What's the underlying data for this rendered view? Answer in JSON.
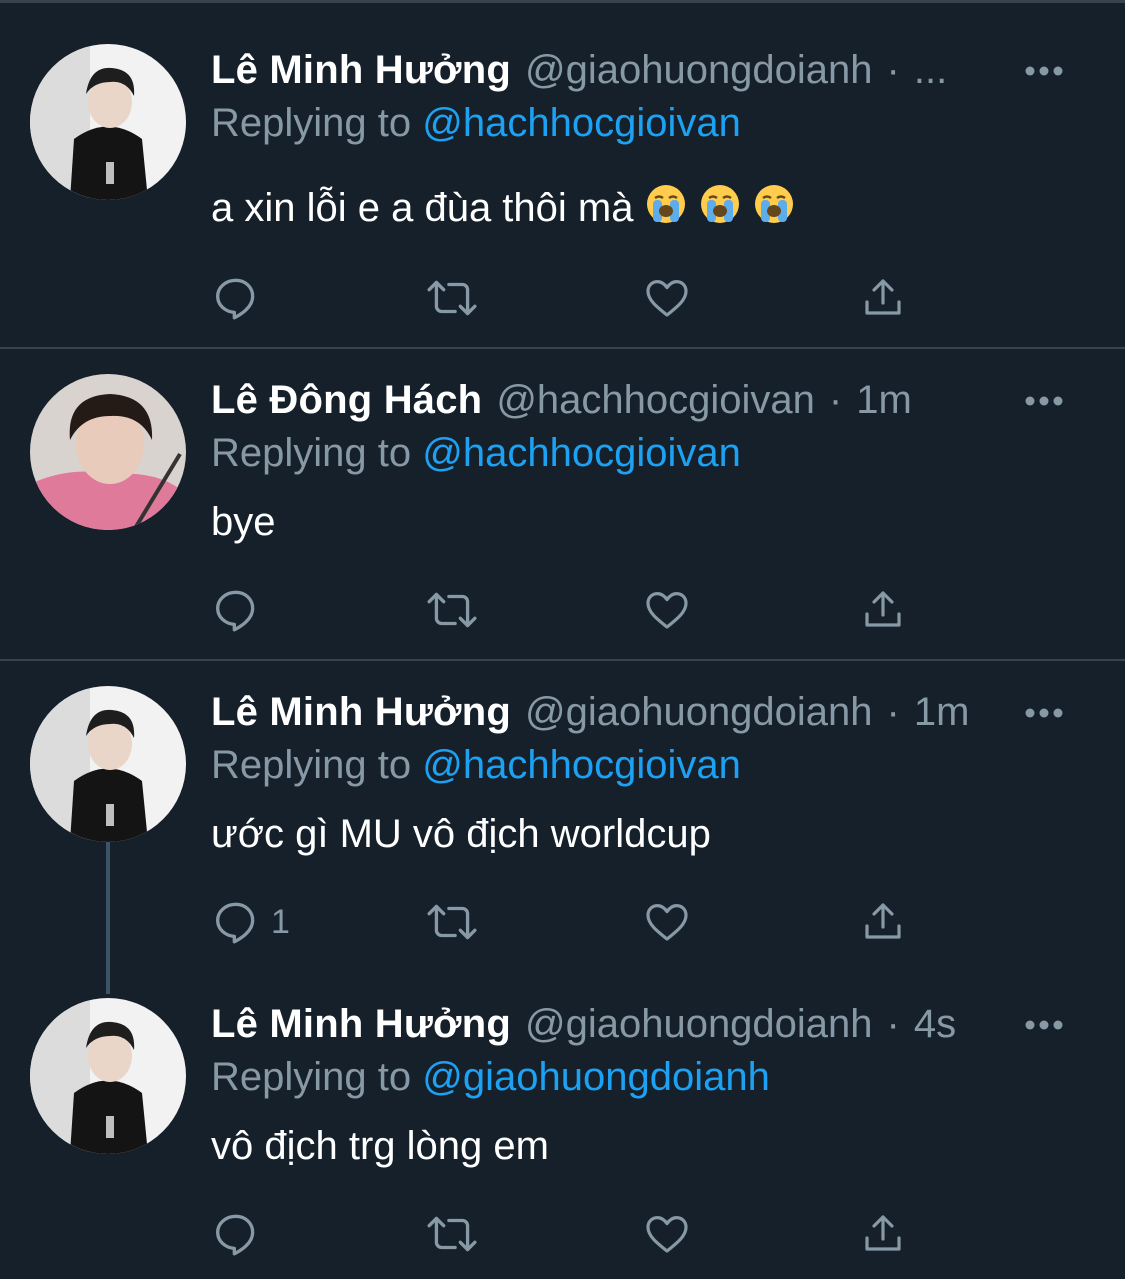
{
  "icons": {
    "reply": "reply-icon",
    "retweet": "retweet-icon",
    "like": "heart-icon",
    "share": "share-icon",
    "more": "more-icon"
  },
  "colors": {
    "background": "#15202b",
    "divider": "#38444d",
    "name": "#ffffff",
    "secondary": "#8899a6",
    "mention": "#1da1f2"
  },
  "tweets": [
    {
      "name": "Lê Minh Hưởng",
      "handle": "@giaohuongdoianh",
      "separator": "·",
      "time": "...",
      "replying_label": "Replying to",
      "replying_to": "@hachhocgioivan",
      "text": "a xin lỗi e a đùa thôi mà",
      "emojis": [
        "loudly-crying-face",
        "loudly-crying-face",
        "loudly-crying-face"
      ],
      "reply_count": ""
    },
    {
      "name": "Lê Đông Hách",
      "handle": "@hachhocgioivan",
      "separator": "·",
      "time": "1m",
      "replying_label": "Replying to",
      "replying_to": "@hachhocgioivan",
      "text": "bye",
      "reply_count": ""
    },
    {
      "name": "Lê Minh Hưởng",
      "handle": "@giaohuongdoianh",
      "separator": "·",
      "time": "1m",
      "replying_label": "Replying to",
      "replying_to": "@hachhocgioivan",
      "text": "ước gì MU vô địch worldcup",
      "reply_count": "1"
    },
    {
      "name": "Lê Minh Hưởng",
      "handle": "@giaohuongdoianh",
      "separator": "·",
      "time": "4s",
      "replying_label": "Replying to",
      "replying_to": "@giaohuongdoianh",
      "text": "vô địch trg lòng em",
      "reply_count": ""
    }
  ]
}
